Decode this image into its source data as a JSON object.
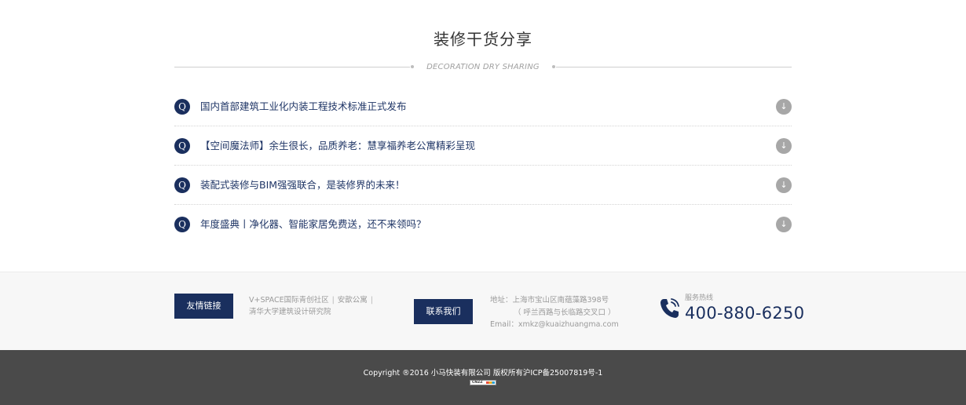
{
  "section": {
    "title": "装修干货分享",
    "subtitle": "DECORATION DRY SHARING",
    "q_label": "Q",
    "arrow_glyph": "↓",
    "items": [
      {
        "text": "国内首部建筑工业化内装工程技术标准正式发布"
      },
      {
        "text": "【空间魔法师】余生很长，品质养老：慧享福养老公寓精彩呈现"
      },
      {
        "text": "装配式装修与BIM强强联合，是装修界的未来！"
      },
      {
        "text": "年度盛典丨净化器、智能家居免费送，还不来领吗？"
      }
    ]
  },
  "footer": {
    "friends_button": "友情链接",
    "links": [
      {
        "label": "V+SPACE国际青创社区"
      },
      {
        "label": "安歆公寓"
      },
      {
        "label": "清华大学建筑设计研究院"
      }
    ],
    "link_separator": "|",
    "contact_button": "联系我们",
    "address_line1": "地址：上海市宝山区南蕴藻路398号",
    "address_line2": "（ 呼兰西路与长临路交叉口 ）",
    "email": "Email：xmkz@kuaizhuangma.com",
    "hotline_label": "服务热线",
    "hotline_number": "400-880-6250",
    "phone_icon": "phone-icon"
  },
  "bottom": {
    "copyright": "Copyright ®2016 小马快装有限公司 版权所有沪ICP备25007819号-1",
    "stat_badge": "CNZZ"
  },
  "colors": {
    "navy": "#1a2f5e",
    "arrow_gray": "#a7a7a7",
    "footer_bg": "#f7f7f7",
    "bottom_bg": "#4a4a4a"
  }
}
